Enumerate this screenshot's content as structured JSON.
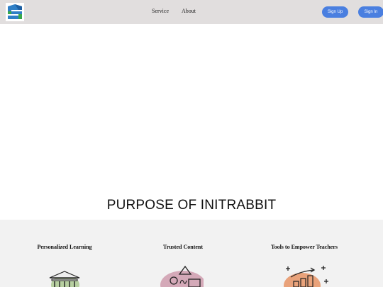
{
  "nav": {
    "links": [
      "Service",
      "About"
    ],
    "signup_label": "Sign Up",
    "signin_label": "Sign In"
  },
  "hero": {
    "title": "PURPOSE OF INITRABBIT"
  },
  "features": [
    {
      "title": "Personalized Learning",
      "icon": "institution-icon"
    },
    {
      "title": "Trusted Content",
      "icon": "shapes-icon"
    },
    {
      "title": "Tools to Empower Teachers",
      "icon": "growth-chart-icon"
    }
  ],
  "colors": {
    "navbar_bg": "#e1dede",
    "button_blue": "#4a7fe0",
    "features_bg": "#f2f2f2"
  }
}
